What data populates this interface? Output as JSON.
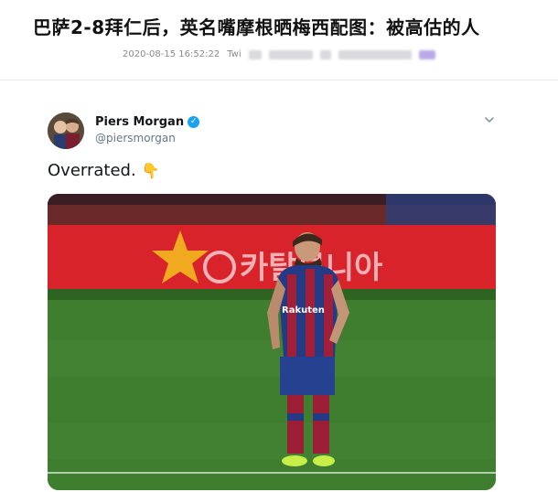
{
  "article": {
    "title": "巴萨2-8拜仁后，英名嘴摩根晒梅西配图：被高估的人",
    "timestamp": "2020-08-15 16:52:22",
    "source_prefix": "Twi"
  },
  "tweet": {
    "display_name": "Piers Morgan",
    "handle": "@piersmorgan",
    "text": "Overrated.",
    "emoji": "👇",
    "more_icon": "chevron-down-icon",
    "verified_icon": "verified-badge-icon"
  },
  "photo": {
    "jersey_sponsor": "Rakuten",
    "colors": {
      "pitch": "#3f7d2f",
      "board": "#d8232a",
      "jersey_blue": "#243a85",
      "jersey_red": "#a21f3a"
    }
  }
}
